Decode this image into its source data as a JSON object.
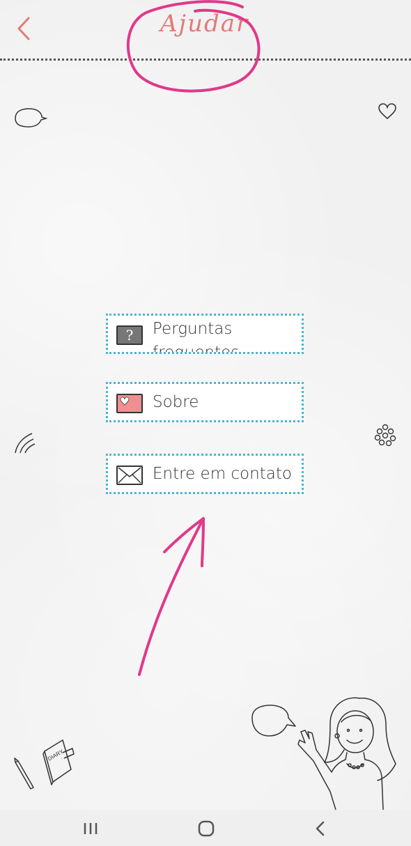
{
  "header": {
    "title": "Ajudar",
    "back_icon": "chevron-left-icon",
    "accent_color": "#e07b78"
  },
  "menu": {
    "items": [
      {
        "label": "Perguntas frequentes",
        "icon": "question-icon"
      },
      {
        "label": "Sobre",
        "icon": "heart-card-icon"
      },
      {
        "label": "Entre em contato",
        "icon": "envelope-icon"
      }
    ],
    "border_color": "#4ab4cf"
  },
  "annotation": {
    "color": "#e0398a",
    "shapes": [
      "circle-around-title",
      "arrow-to-contact"
    ]
  },
  "navbar": {
    "icons": [
      "recent-apps-icon",
      "home-icon",
      "back-icon"
    ]
  }
}
